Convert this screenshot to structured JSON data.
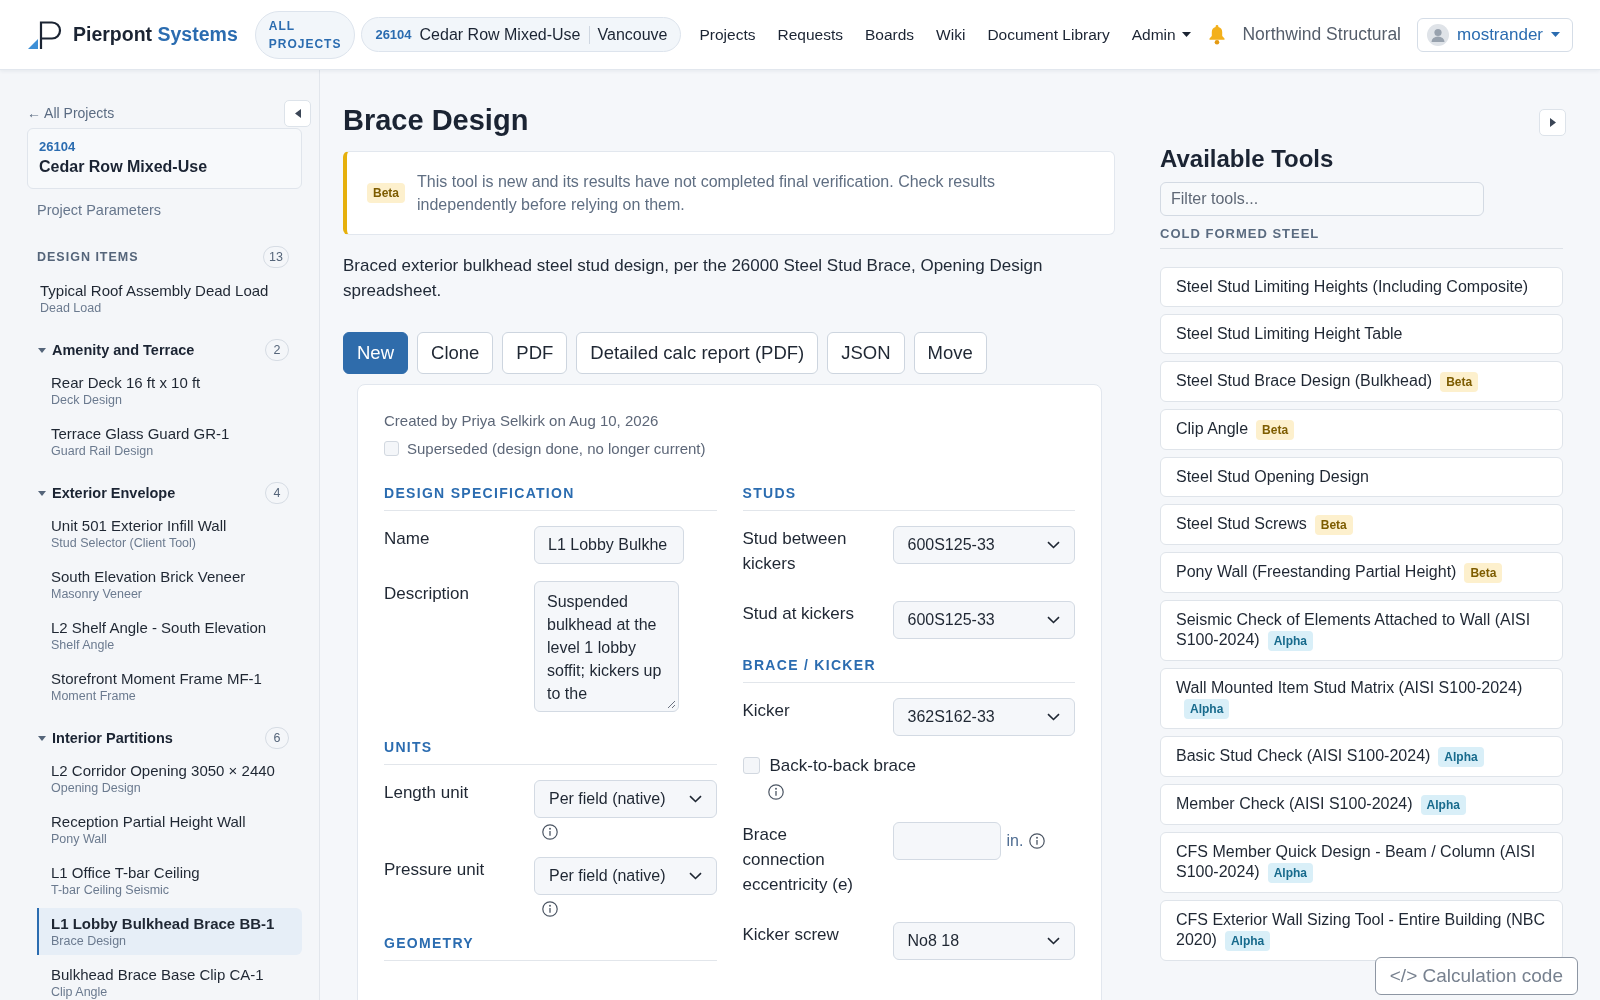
{
  "header": {
    "brand": {
      "name": "Pierpont",
      "accent": "Systems"
    },
    "all_projects": "ALL PROJECTS",
    "project": {
      "number": "26104",
      "name": "Cedar Row Mixed-Use",
      "location": "Vancouve"
    },
    "nav": [
      {
        "label": "Projects",
        "kind": "link"
      },
      {
        "label": "Requests",
        "kind": "link"
      },
      {
        "label": "Boards",
        "kind": "link"
      },
      {
        "label": "Wiki",
        "kind": "link"
      },
      {
        "label": "Document Library",
        "kind": "link"
      },
      {
        "label": "Admin",
        "kind": "dropdown"
      }
    ],
    "organization": "Northwind Structural",
    "user": "mostrander"
  },
  "sidebar": {
    "back_link": "← All Projects",
    "project": {
      "number": "26104",
      "name": "Cedar Row Mixed-Use"
    },
    "parameters_link": "Project Parameters",
    "section": {
      "title": "DESIGN ITEMS",
      "count": "13"
    },
    "items": [
      {
        "kind": "item",
        "title": "Typical Roof Assembly Dead Load",
        "subtitle": "Dead Load",
        "selected": false
      },
      {
        "kind": "group",
        "title": "Amenity and Terrace",
        "count": "2",
        "expanded": true,
        "children": [
          {
            "kind": "item",
            "title": "Rear Deck 16 ft x 10 ft",
            "subtitle": "Deck Design",
            "selected": false
          },
          {
            "kind": "item",
            "title": "Terrace Glass Guard GR-1",
            "subtitle": "Guard Rail Design",
            "selected": false
          }
        ]
      },
      {
        "kind": "group",
        "title": "Exterior Envelope",
        "count": "4",
        "expanded": true,
        "children": [
          {
            "kind": "item",
            "title": "Unit 501 Exterior Infill Wall",
            "subtitle": "Stud Selector (Client Tool)",
            "selected": false
          },
          {
            "kind": "item",
            "title": "South Elevation Brick Veneer",
            "subtitle": "Masonry Veneer",
            "selected": false
          },
          {
            "kind": "item",
            "title": "L2 Shelf Angle - South Elevation",
            "subtitle": "Shelf Angle",
            "selected": false
          },
          {
            "kind": "item",
            "title": "Storefront Moment Frame MF-1",
            "subtitle": "Moment Frame",
            "selected": false
          }
        ]
      },
      {
        "kind": "group",
        "title": "Interior Partitions",
        "count": "6",
        "expanded": true,
        "children": [
          {
            "kind": "item",
            "title": "L2 Corridor Opening 3050 × 2440",
            "subtitle": "Opening Design",
            "selected": false
          },
          {
            "kind": "item",
            "title": "Reception Partial Height Wall",
            "subtitle": "Pony Wall",
            "selected": false
          },
          {
            "kind": "item",
            "title": "L1 Office T-bar Ceiling",
            "subtitle": "T-bar Ceiling Seismic",
            "selected": false
          },
          {
            "kind": "item",
            "title": "L1 Lobby Bulkhead Brace BB-1",
            "subtitle": "Brace Design",
            "selected": true
          },
          {
            "kind": "item",
            "title": "Bulkhead Brace Base Clip CA-1",
            "subtitle": "Clip Angle",
            "selected": false
          }
        ]
      }
    ]
  },
  "main": {
    "title": "Brace Design",
    "notice": {
      "badge": "Beta",
      "text": "This tool is new and its results have not completed final verification. Check results independently before relying on them."
    },
    "description": "Braced exterior bulkhead steel stud design, per the 26000 Steel Stud Brace, Opening Design spreadsheet.",
    "actions": [
      {
        "label": "New",
        "kind": "primary"
      },
      {
        "label": "Clone",
        "kind": "default"
      },
      {
        "label": "PDF",
        "kind": "default"
      },
      {
        "label": "Detailed calc report (PDF)",
        "kind": "default"
      },
      {
        "label": "JSON",
        "kind": "default"
      },
      {
        "label": "Move",
        "kind": "default"
      }
    ],
    "form": {
      "meta": "Created by Priya Selkirk on Aug 10, 2026",
      "superseded": {
        "label": "Superseded (design done, no longer current)",
        "checked": false
      },
      "columns": [
        {
          "sections": [
            {
              "title": "DESIGN SPECIFICATION",
              "fields": [
                {
                  "kind": "input",
                  "label": "Name",
                  "value": "L1 Lobby Bulkhe"
                },
                {
                  "kind": "textarea",
                  "label": "Description",
                  "value": "Suspended bulkhead at the level 1 lobby soffit; kickers up to the"
                }
              ]
            },
            {
              "title": "UNITS",
              "fields": [
                {
                  "kind": "select",
                  "label": "Length unit",
                  "value": "Per field (native)",
                  "info": true
                },
                {
                  "kind": "select",
                  "label": "Pressure unit",
                  "value": "Per field (native)",
                  "info": true
                }
              ]
            },
            {
              "title": "GEOMETRY"
            }
          ]
        },
        {
          "sections": [
            {
              "title": "STUDS",
              "fields": [
                {
                  "kind": "select",
                  "label": "Stud between kickers",
                  "value": "600S125-33"
                },
                {
                  "kind": "select",
                  "label": "Stud at kickers",
                  "value": "600S125-33"
                }
              ]
            },
            {
              "title": "BRACE / KICKER",
              "fields": [
                {
                  "kind": "select",
                  "label": "Kicker",
                  "value": "362S162-33"
                },
                {
                  "kind": "checkbox",
                  "label": "Back-to-back brace",
                  "checked": false,
                  "info": true
                },
                {
                  "kind": "input",
                  "label": "Brace connection eccentricity (e)",
                  "unit": "in.",
                  "info": true
                },
                {
                  "kind": "select",
                  "label": "Kicker screw",
                  "value": "No8 18"
                }
              ]
            }
          ]
        }
      ]
    }
  },
  "tools": {
    "title": "Available Tools",
    "filter": {
      "placeholder": "Filter tools..."
    },
    "category": "COLD FORMED STEEL",
    "items": [
      {
        "name": "Steel Stud Limiting Heights (Including Composite)"
      },
      {
        "name": "Steel Stud Limiting Height Table"
      },
      {
        "name": "Steel Stud Brace Design (Bulkhead)",
        "badge": {
          "label": "Beta",
          "kind": "beta"
        }
      },
      {
        "name": "Clip Angle",
        "badge": {
          "label": "Beta",
          "kind": "beta"
        }
      },
      {
        "name": "Steel Stud Opening Design"
      },
      {
        "name": "Steel Stud Screws",
        "badge": {
          "label": "Beta",
          "kind": "beta"
        }
      },
      {
        "name": "Pony Wall (Freestanding Partial Height)",
        "badge": {
          "label": "Beta",
          "kind": "beta"
        }
      },
      {
        "name": "Seismic Check of Elements Attached to Wall (AISI S100-2024)",
        "badge": {
          "label": "Alpha",
          "kind": "alpha"
        }
      },
      {
        "name": "Wall Mounted Item Stud Matrix (AISI S100-2024)",
        "badge": {
          "label": "Alpha",
          "kind": "alpha"
        }
      },
      {
        "name": "Basic Stud Check (AISI S100-2024)",
        "badge": {
          "label": "Alpha",
          "kind": "alpha"
        }
      },
      {
        "name": "Member Check (AISI S100-2024)",
        "badge": {
          "label": "Alpha",
          "kind": "alpha"
        }
      },
      {
        "name": "CFS Member Quick Design - Beam / Column (AISI S100-2024)",
        "badge": {
          "label": "Alpha",
          "kind": "alpha"
        }
      },
      {
        "name": "CFS Exterior Wall Sizing Tool - Entire Building (NBC 2020)",
        "badge": {
          "label": "Alpha",
          "kind": "alpha"
        }
      }
    ]
  },
  "floating_button": "</> Calculation code"
}
